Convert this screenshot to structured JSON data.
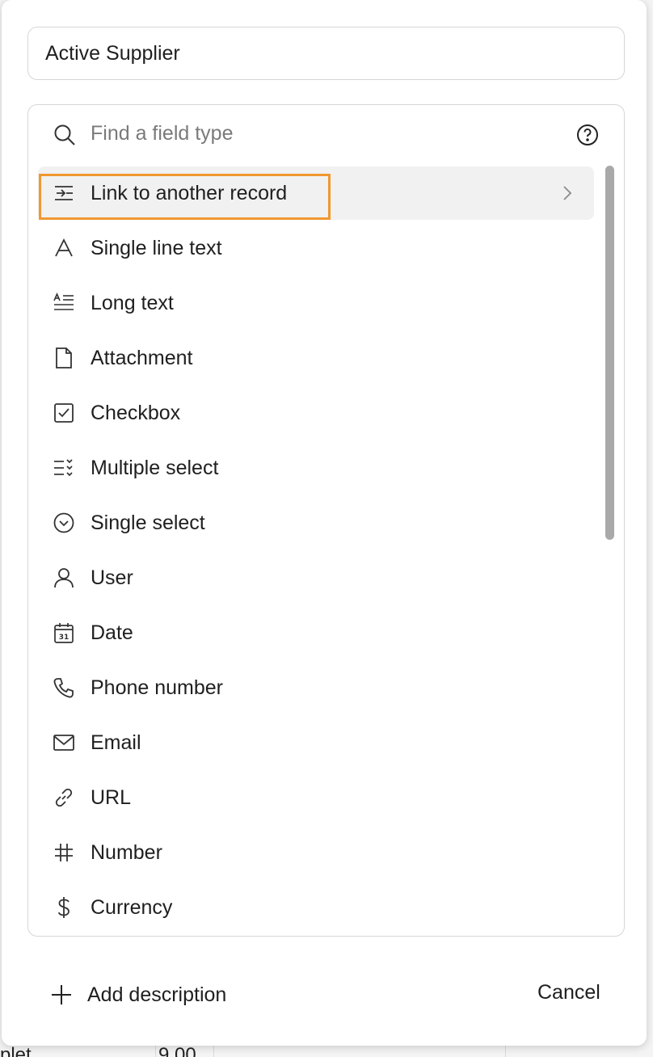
{
  "field_name": {
    "value": "Active Supplier"
  },
  "search": {
    "placeholder": "Find a field type"
  },
  "field_types": [
    {
      "label": "Link to another record",
      "icon": "link-record-icon",
      "selected": true
    },
    {
      "label": "Single line text",
      "icon": "text-a-icon"
    },
    {
      "label": "Long text",
      "icon": "long-text-icon"
    },
    {
      "label": "Attachment",
      "icon": "document-icon"
    },
    {
      "label": "Checkbox",
      "icon": "checkbox-icon"
    },
    {
      "label": "Multiple select",
      "icon": "multi-select-icon"
    },
    {
      "label": "Single select",
      "icon": "chevron-circle-icon"
    },
    {
      "label": "User",
      "icon": "user-icon"
    },
    {
      "label": "Date",
      "icon": "calendar-icon"
    },
    {
      "label": "Phone number",
      "icon": "phone-icon"
    },
    {
      "label": "Email",
      "icon": "envelope-icon"
    },
    {
      "label": "URL",
      "icon": "link-icon"
    },
    {
      "label": "Number",
      "icon": "hash-icon"
    },
    {
      "label": "Currency",
      "icon": "dollar-icon"
    }
  ],
  "footer": {
    "add_description": "Add description",
    "cancel": "Cancel"
  },
  "background": {
    "cell_left": "plet",
    "cell_right": "9.00"
  },
  "colors": {
    "highlight": "#f0982f",
    "selected_bg": "#f1f1f1"
  }
}
